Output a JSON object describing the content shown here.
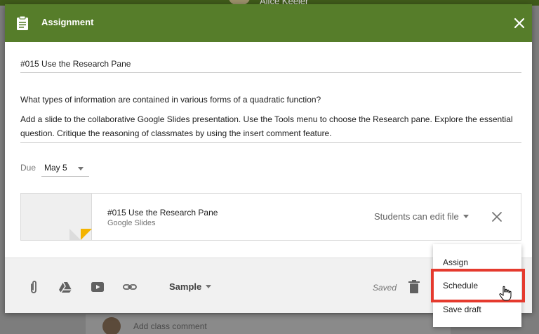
{
  "background": {
    "top_user_name": "Alice Keeler",
    "comment_placeholder": "Add class comment"
  },
  "dialog": {
    "title": "Assignment",
    "header_color": "#567d2a",
    "header_icon": "clipboard-icon",
    "close_icon": "close-icon"
  },
  "assignment": {
    "title": "#015 Use the Research Pane",
    "description": [
      "What types of information are contained in various forms of a quadratic function?",
      "Add a slide to the collaborative Google Slides presentation. Use the Tools menu to choose the Research pane. Explore the essential question. Critique the reasoning of classmates by using the insert comment feature."
    ]
  },
  "due": {
    "label": "Due",
    "value": "May 5"
  },
  "attachment": {
    "title": "#015 Use the Research Pane",
    "type": "Google Slides",
    "permission": "Students can edit file",
    "thumb_accent": "#f4b400"
  },
  "footer": {
    "tools": [
      "paperclip-icon",
      "drive-icon",
      "youtube-icon",
      "link-icon"
    ],
    "class_select": "Sample",
    "status": "Saved"
  },
  "menu": {
    "items": [
      "Assign",
      "Schedule",
      "Save draft"
    ],
    "highlighted": "Schedule",
    "highlight_color": "#e53a2e"
  }
}
